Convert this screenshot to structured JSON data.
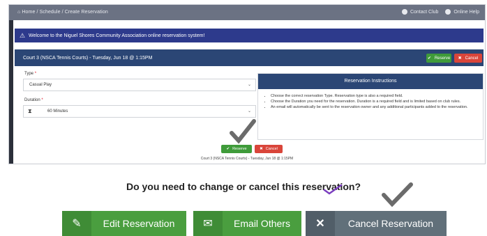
{
  "topbar": {
    "breadcrumb": "⌂ Home / Schedule / Create Reservation",
    "contact": "Contact Club",
    "help": "Online Help"
  },
  "banner": {
    "text": "Welcome to the Niguel Shores Community Association online reservation system!"
  },
  "panel": {
    "title": "Court 3 (NSCA Tennis Courts) - Tuesday, Jun 18 @ 1:15PM",
    "reserve_label": "Reserve",
    "cancel_label": "Cancel"
  },
  "form": {
    "type_label": "Type",
    "type_value": "Casual Play",
    "duration_label": "Duration",
    "duration_value": "60 Minutes"
  },
  "instructions": {
    "title": "Reservation Instructions",
    "items": [
      "Choose the correct reservation Type. Reservation type is also a required field.",
      "Choose the Duration you need for the reservation. Duration is a required field and is limited based on club rules.",
      "An email will automatically be sent to the reservation owner and any additional participants added to the reservation."
    ]
  },
  "footer_buttons": {
    "reserve_label": "Reserve",
    "cancel_label": "Cancel"
  },
  "footnote": "Court 3 (NSCA Tennis Courts) - Tuesday, Jun 18 @ 1:15PM",
  "question": "Do you need to change or cancel this reservation?",
  "actions": {
    "edit": "Edit Reservation",
    "email": "Email Others",
    "cancel": "Cancel Reservation"
  },
  "colors": {
    "green": "#4a9e3f",
    "navy": "#2b4675",
    "banner": "#2d3a8c",
    "red": "#d9453a",
    "slate": "#61707a"
  }
}
